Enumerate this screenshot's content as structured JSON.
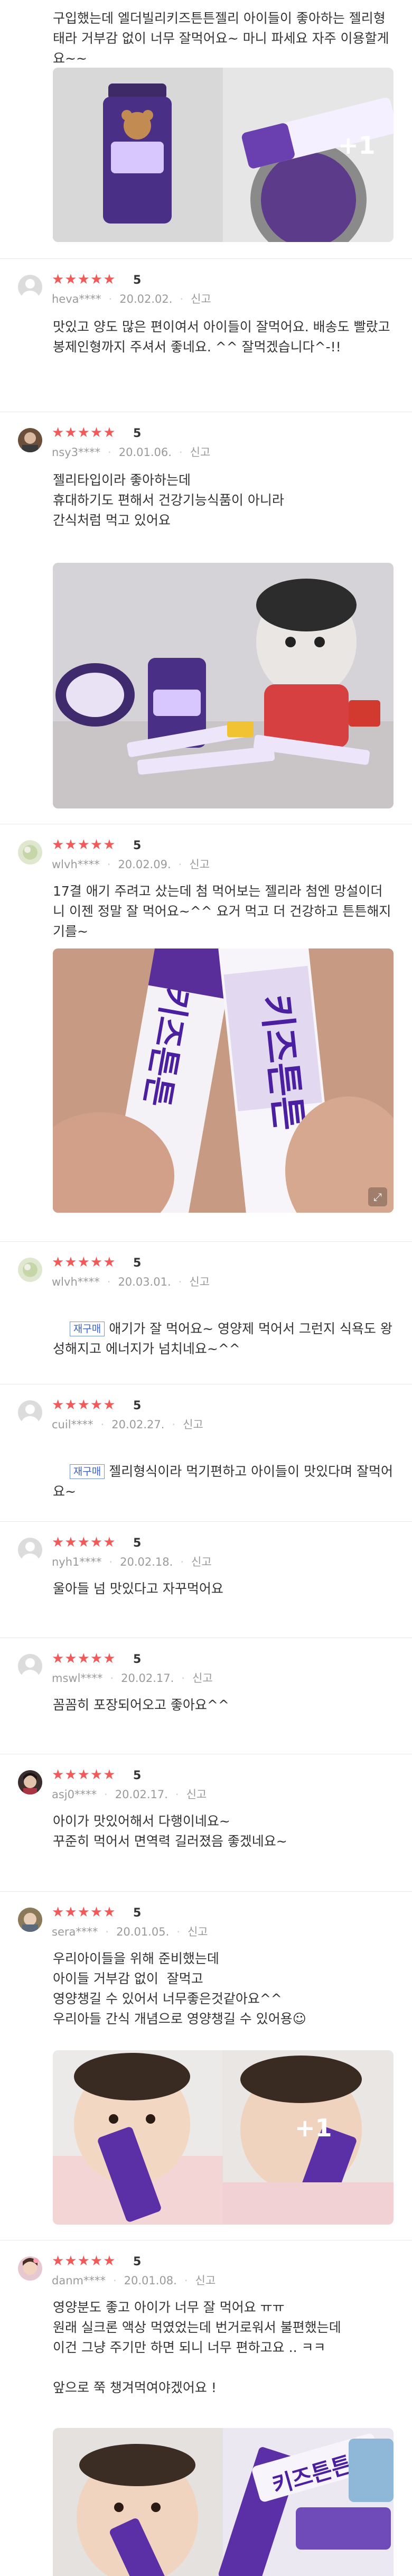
{
  "common": {
    "report_label": "신고",
    "plus_label": "+1",
    "expand_glyph": "⤢",
    "star_glyphs": "★★★★★",
    "repurchase_label": "재구매"
  },
  "reviews": [
    {
      "text": "구입했는데 엘더빌리키즈튼튼젤리 아이들이 좋아하는 젤리형태라 거부감 없이 너무 잘먹어요~ 마니 파세요 자주 이용할게요~~"
    },
    {
      "score": "5",
      "author": "heva****",
      "date": "20.02.02.",
      "text": "맛있고 양도 많은 편이여서 아이들이 잘먹어요. 배송도 빨랐고 봉제인형까지 주셔서 좋네요. ^^ 잘먹겠습니다^-!!"
    },
    {
      "score": "5",
      "author": "nsy3****",
      "date": "20.01.06.",
      "text": "젤리타입이라 좋아하는데\n휴대하기도 편해서 건강기능식품이 아니라\n간식처럼 먹고 있어요"
    },
    {
      "score": "5",
      "author": "wlvh****",
      "date": "20.02.09.",
      "text": "17결 애기 주려고 샀는데 첨 먹어보는 젤리라 첨엔 망설이더니 이젠 정말 잘 먹어요~^^ 요거 먹고 더 건강하고 튼튼해지기를~"
    },
    {
      "score": "5",
      "author": "wlvh****",
      "date": "20.03.01.",
      "text": "애기가 잘 먹어요~ 영양제 먹어서 그런지 식욕도 왕성해지고 에너지가 넘치네요~^^"
    },
    {
      "score": "5",
      "author": "cuil****",
      "date": "20.02.27.",
      "text": "젤리형식이라 먹기편하고 아이들이 맛있다며 잘먹어요~"
    },
    {
      "score": "5",
      "author": "nyh1****",
      "date": "20.02.18.",
      "text": "울아들 넘 맛있다고 자꾸먹어요"
    },
    {
      "score": "5",
      "author": "mswl****",
      "date": "20.02.17.",
      "text": "꼼꼼히 포장되어오고 좋아요^^"
    },
    {
      "score": "5",
      "author": "asj0****",
      "date": "20.02.17.",
      "text": "아이가 맛있어해서 다행이네요~\n꾸준히 먹어서 면역력 길러졌음 좋겠네요~"
    },
    {
      "score": "5",
      "author": "sera****",
      "date": "20.01.05.",
      "text": "우리아이들을 위해 준비했는데\n아이들 거부감 없이  잘먹고\n영양챙길 수 있어서 너무좋은것같아요^^\n우리아들 간식 개념으로 영양챙길 수 있어용☺"
    },
    {
      "score": "5",
      "author": "danm****",
      "date": "20.01.08.",
      "text": "영양분도 좋고 아이가 너무 잘 먹어요 ㅠㅠ\n원래 실크론 액상 먹였었는데 번거로워서 불편했는데\n이건 그냥 주기만 하면 되니 너무 편하고요 .. ㅋㅋ\n\n앞으로 쭉 챙겨먹여야겠어요 !"
    }
  ]
}
